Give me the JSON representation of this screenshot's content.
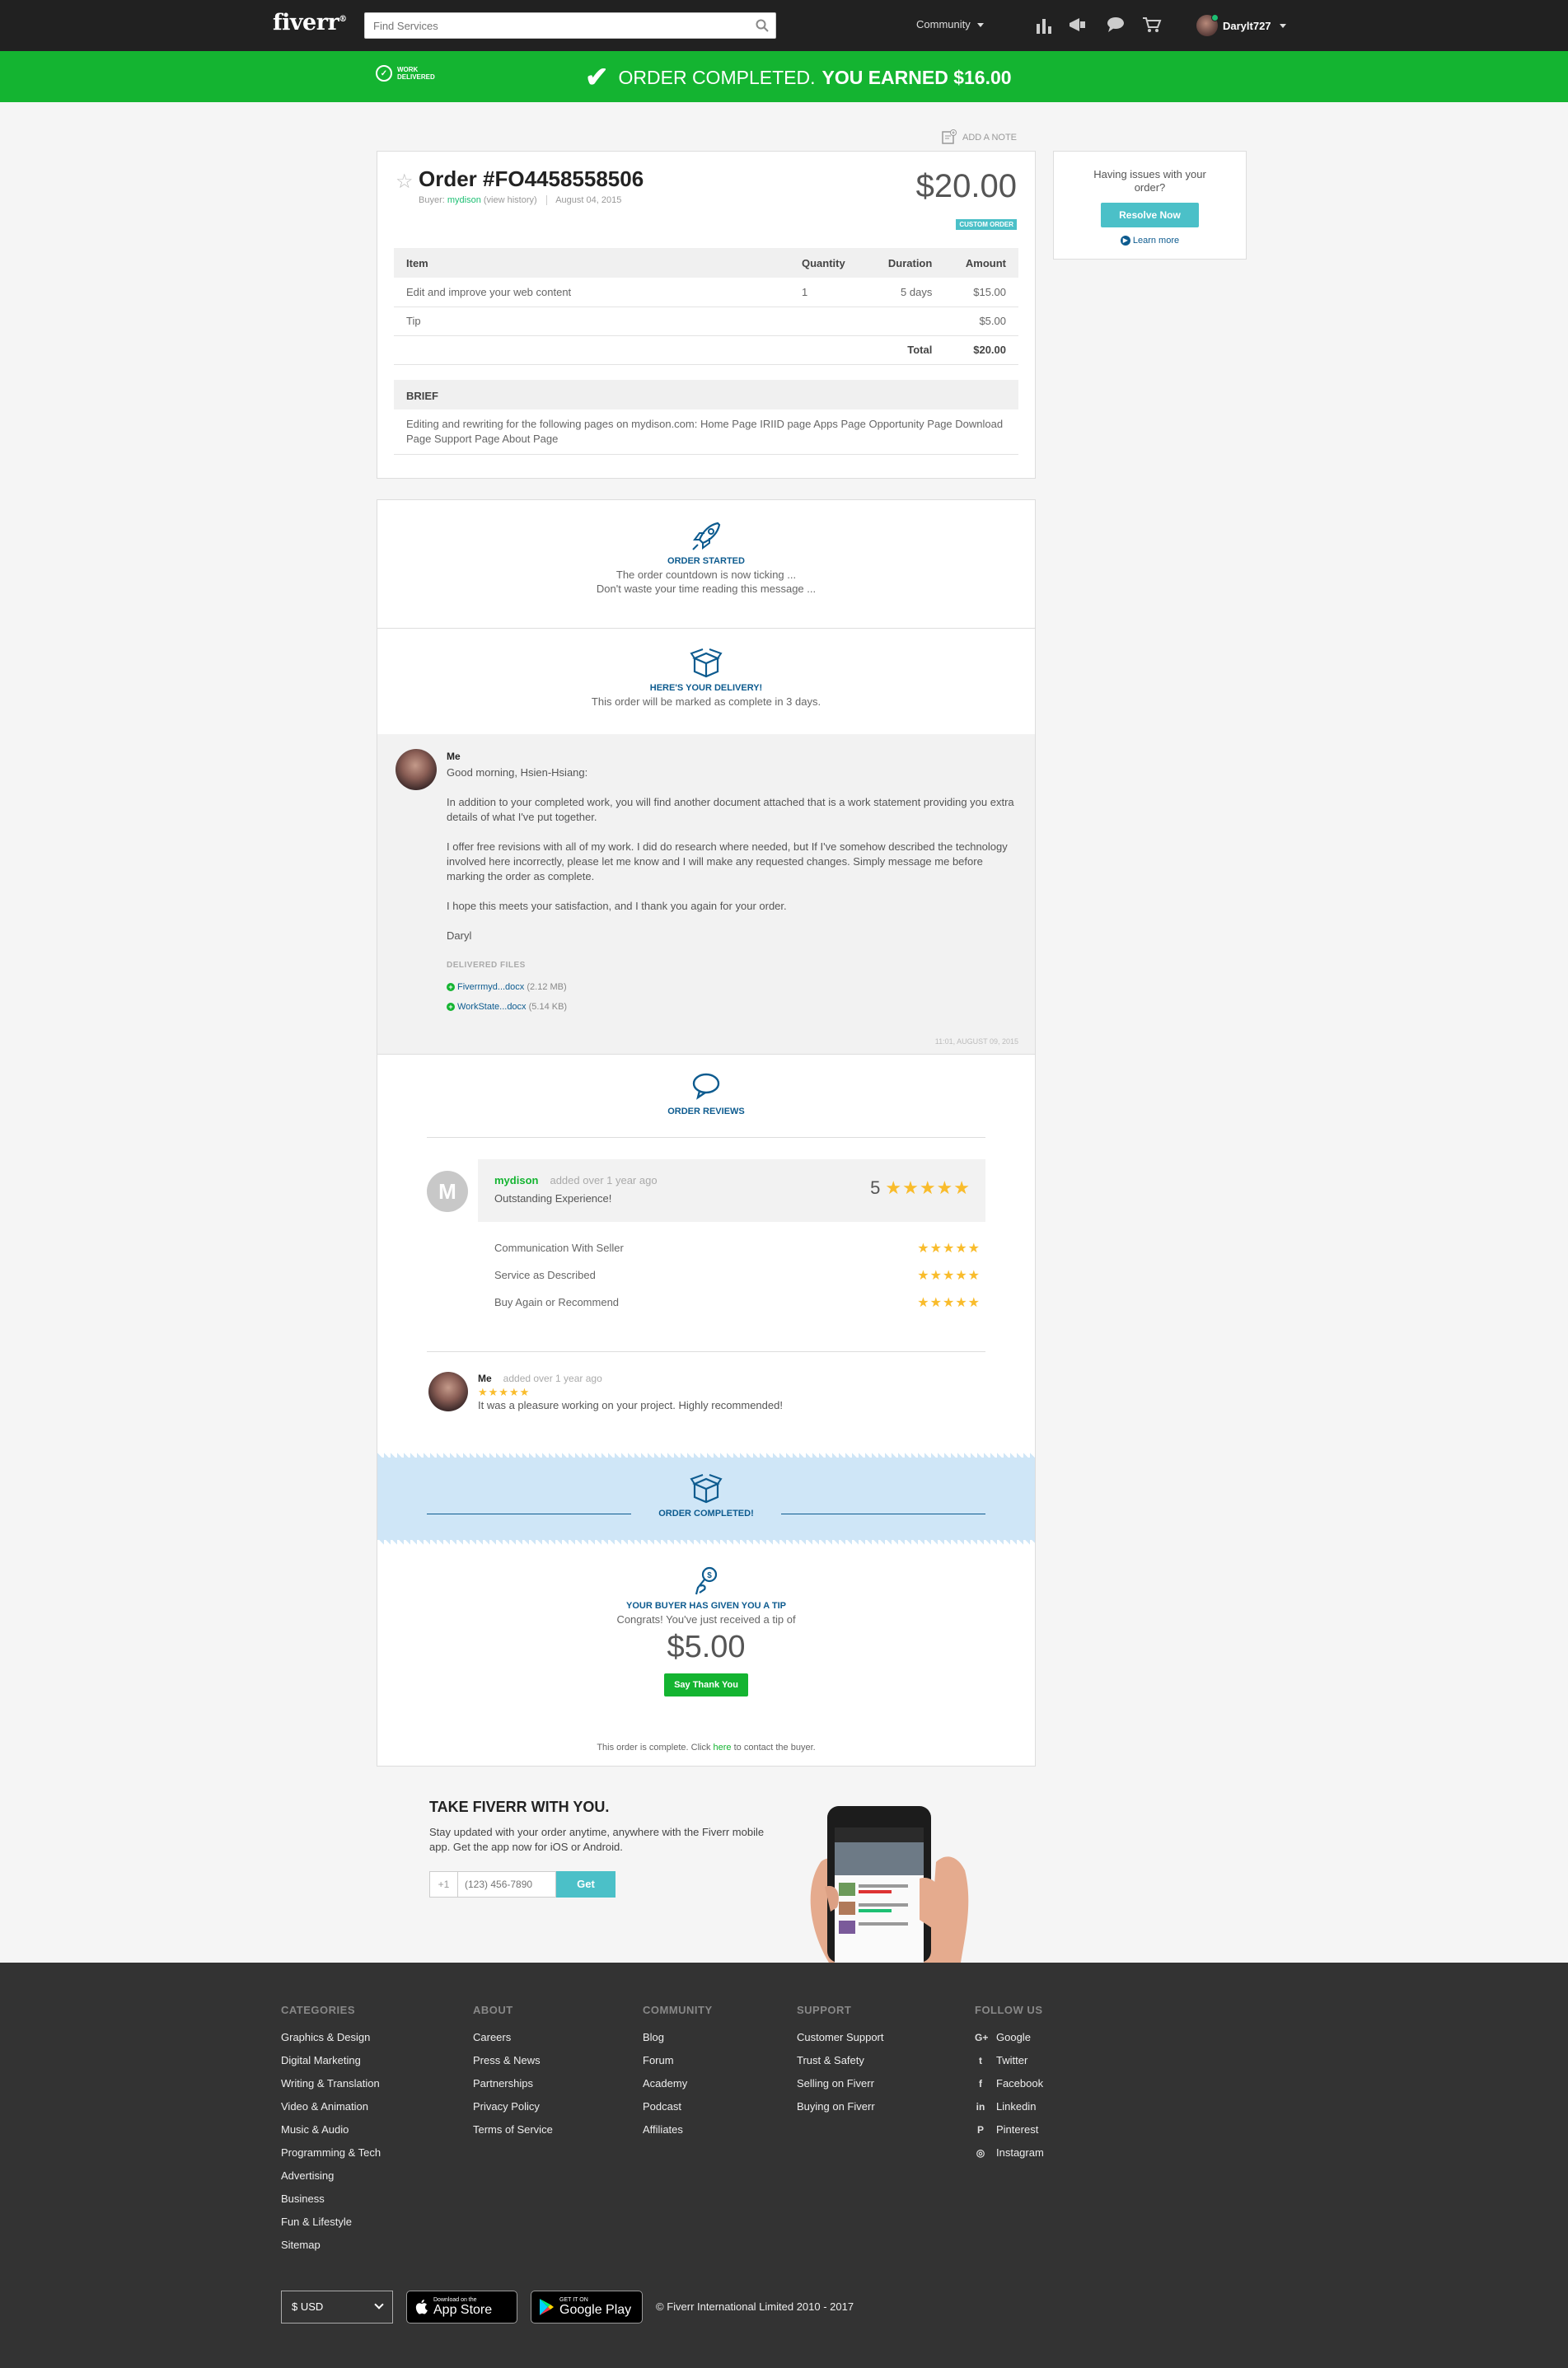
{
  "nav": {
    "logo": "fiverr",
    "search_placeholder": "Find Services",
    "community_label": "Community",
    "username": "Darylt727",
    "icons": [
      "stats-icon",
      "megaphone-icon",
      "chat-icon",
      "cart-icon"
    ]
  },
  "banner": {
    "work_delivered_line1": "WORK",
    "work_delivered_line2": "DELIVERED",
    "completed_text": "ORDER COMPLETED.",
    "earned_text": "YOU EARNED $16.00",
    "color": "#14b431"
  },
  "add_note": "ADD A NOTE",
  "order": {
    "title": "Order #FO4458558506",
    "buyer_label": "Buyer:",
    "buyer_name": "mydison",
    "view_history": "(view history)",
    "date": "August 04, 2015",
    "price": "$20.00",
    "badge": "CUSTOM ORDER",
    "table_headers": [
      "Item",
      "Quantity",
      "Duration",
      "Amount"
    ],
    "rows": [
      {
        "item": "Edit and improve your web content",
        "quantity": "1",
        "duration": "5 days",
        "amount": "$15.00"
      },
      {
        "item": "Tip",
        "quantity": "",
        "duration": "",
        "amount": "$5.00"
      }
    ],
    "total_label": "Total",
    "total_value": "$20.00",
    "brief_label": "BRIEF",
    "brief_text": "Editing and rewriting for the following pages on mydison.com: Home Page IRIID page Apps Page Opportunity Page Download Page Support Page About Page"
  },
  "side": {
    "question": "Having issues with your order?",
    "resolve_button": "Resolve Now",
    "learn_more": "Learn more"
  },
  "timeline": {
    "started_label": "ORDER STARTED",
    "started_line1": "The order countdown is now ticking ...",
    "started_line2": "Don't waste your time reading this message ...",
    "delivery_label": "HERE'S YOUR DELIVERY!",
    "delivery_text": "This order will be marked as complete in 3 days.",
    "message": {
      "author": "Me",
      "paragraphs": [
        "Good morning, Hsien-Hsiang:",
        "In addition to your completed work, you will find another document attached that is a work statement providing you extra details of what I've put together.",
        "I offer free revisions with all of my work. I did do research where needed, but If I've somehow described the technology involved here incorrectly, please let me know and I will make any requested changes. Simply message me before marking the order as complete.",
        "I hope this meets your satisfaction, and I thank you again for your order.",
        "Daryl"
      ],
      "delivered_files_label": "DELIVERED FILES",
      "files": [
        {
          "name": "Fiverrmyd...docx",
          "size": "(2.12 MB)"
        },
        {
          "name": "WorkState...docx",
          "size": "(5.14 KB)"
        }
      ],
      "timestamp": "11:01, AUGUST 09, 2015"
    },
    "reviews_label": "ORDER REVIEWS",
    "buyer_review": {
      "initial": "M",
      "name": "mydison",
      "when": "added over 1 year ago",
      "text": "Outstanding Experience!",
      "score": "5",
      "rating": 5
    },
    "criteria": [
      {
        "label": "Communication With Seller",
        "rating": 5
      },
      {
        "label": "Service as Described",
        "rating": 5
      },
      {
        "label": "Buy Again or Recommend",
        "rating": 5
      }
    ],
    "seller_review": {
      "name": "Me",
      "when": "added over 1 year ago",
      "text": "It was a pleasure working on your project. Highly recommended!",
      "rating": 5
    },
    "completed_label": "ORDER COMPLETED!",
    "tip_label": "YOUR BUYER HAS GIVEN YOU A TIP",
    "tip_text": "Congrats! You've just received a tip of",
    "tip_amount": "$5.00",
    "thank_button": "Say Thank You",
    "complete_note_pre": "This order is complete. Click ",
    "complete_note_link": "here",
    "complete_note_post": " to contact the buyer."
  },
  "app": {
    "title": "TAKE FIVERR WITH YOU.",
    "text": "Stay updated with your order anytime, anywhere with the Fiverr mobile app. Get the app now for iOS or Android.",
    "country_code": "+1",
    "phone_placeholder": "(123) 456-7890",
    "get_button": "Get"
  },
  "footer": {
    "columns": [
      {
        "title": "CATEGORIES",
        "links": [
          "Graphics & Design",
          "Digital Marketing",
          "Writing & Translation",
          "Video & Animation",
          "Music & Audio",
          "Programming & Tech",
          "Advertising",
          "Business",
          "Fun & Lifestyle",
          "Sitemap"
        ]
      },
      {
        "title": "ABOUT",
        "links": [
          "Careers",
          "Press & News",
          "Partnerships",
          "Privacy Policy",
          "Terms of Service"
        ]
      },
      {
        "title": "COMMUNITY",
        "links": [
          "Blog",
          "Forum",
          "Academy",
          "Podcast",
          "Affiliates"
        ]
      },
      {
        "title": "SUPPORT",
        "links": [
          "Customer Support",
          "Trust & Safety",
          "Selling on Fiverr",
          "Buying on Fiverr"
        ]
      },
      {
        "title": "FOLLOW US",
        "links": [
          "Google",
          "Twitter",
          "Facebook",
          "Linkedin",
          "Pinterest",
          "Instagram"
        ]
      }
    ],
    "social_glyphs": [
      "G+",
      "t",
      "f",
      "in",
      "P",
      "◎"
    ],
    "currency": "$ USD",
    "appstore_small": "Download on the",
    "appstore_big": "App Store",
    "googleplay_small": "GET IT ON",
    "googleplay_big": "Google Play",
    "copyright": "© Fiverr International Limited 2010 - 2017"
  }
}
